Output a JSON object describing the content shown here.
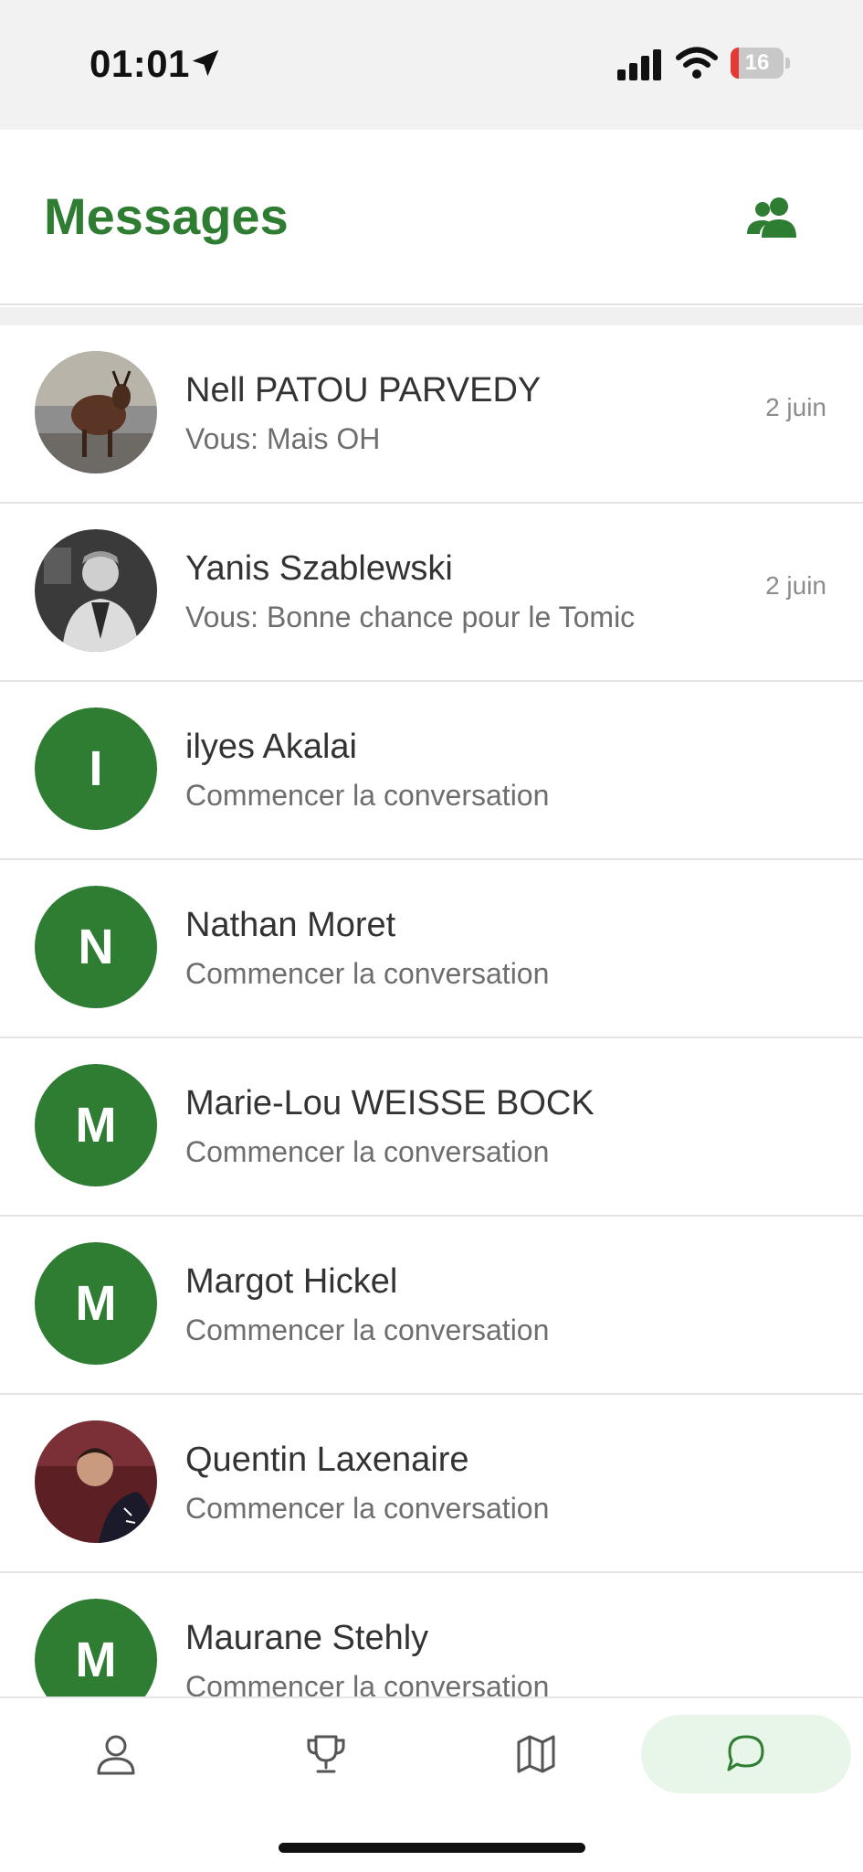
{
  "status_bar": {
    "time": "01:01",
    "battery_level": "16",
    "battery_percent": 16
  },
  "header": {
    "title": "Messages",
    "contacts_icon": "people-icon"
  },
  "conversations": [
    {
      "name": "Nell PATOU PARVEDY",
      "preview": "Vous: Mais OH",
      "date": "2 juin",
      "avatar_type": "photo-goat"
    },
    {
      "name": "Yanis Szablewski",
      "preview": "Vous: Bonne chance pour le Tomic",
      "date": "2 juin",
      "avatar_type": "photo-person-bw"
    },
    {
      "name": "ilyes Akalai",
      "preview": "Commencer la conversation",
      "date": "",
      "initial": "I"
    },
    {
      "name": "Nathan Moret",
      "preview": "Commencer la conversation",
      "date": "",
      "initial": "N"
    },
    {
      "name": "Marie-Lou WEISSE BOCK",
      "preview": "Commencer la conversation",
      "date": "",
      "initial": "M"
    },
    {
      "name": "Margot Hickel",
      "preview": "Commencer la conversation",
      "date": "",
      "initial": "M"
    },
    {
      "name": "Quentin Laxenaire",
      "preview": "Commencer la conversation",
      "date": "",
      "avatar_type": "photo-person-sport"
    },
    {
      "name": "Maurane Stehly",
      "preview": "Commencer la conversation",
      "date": "",
      "initial": "M"
    }
  ],
  "bottom_nav": {
    "items": [
      {
        "icon": "profile-icon",
        "active": false
      },
      {
        "icon": "trophy-icon",
        "active": false
      },
      {
        "icon": "map-icon",
        "active": false
      },
      {
        "icon": "chat-icon",
        "active": true
      }
    ]
  },
  "colors": {
    "accent": "#2e7d32",
    "active_tab_bg": "#e8f5e9",
    "battery_low": "#e53935"
  }
}
